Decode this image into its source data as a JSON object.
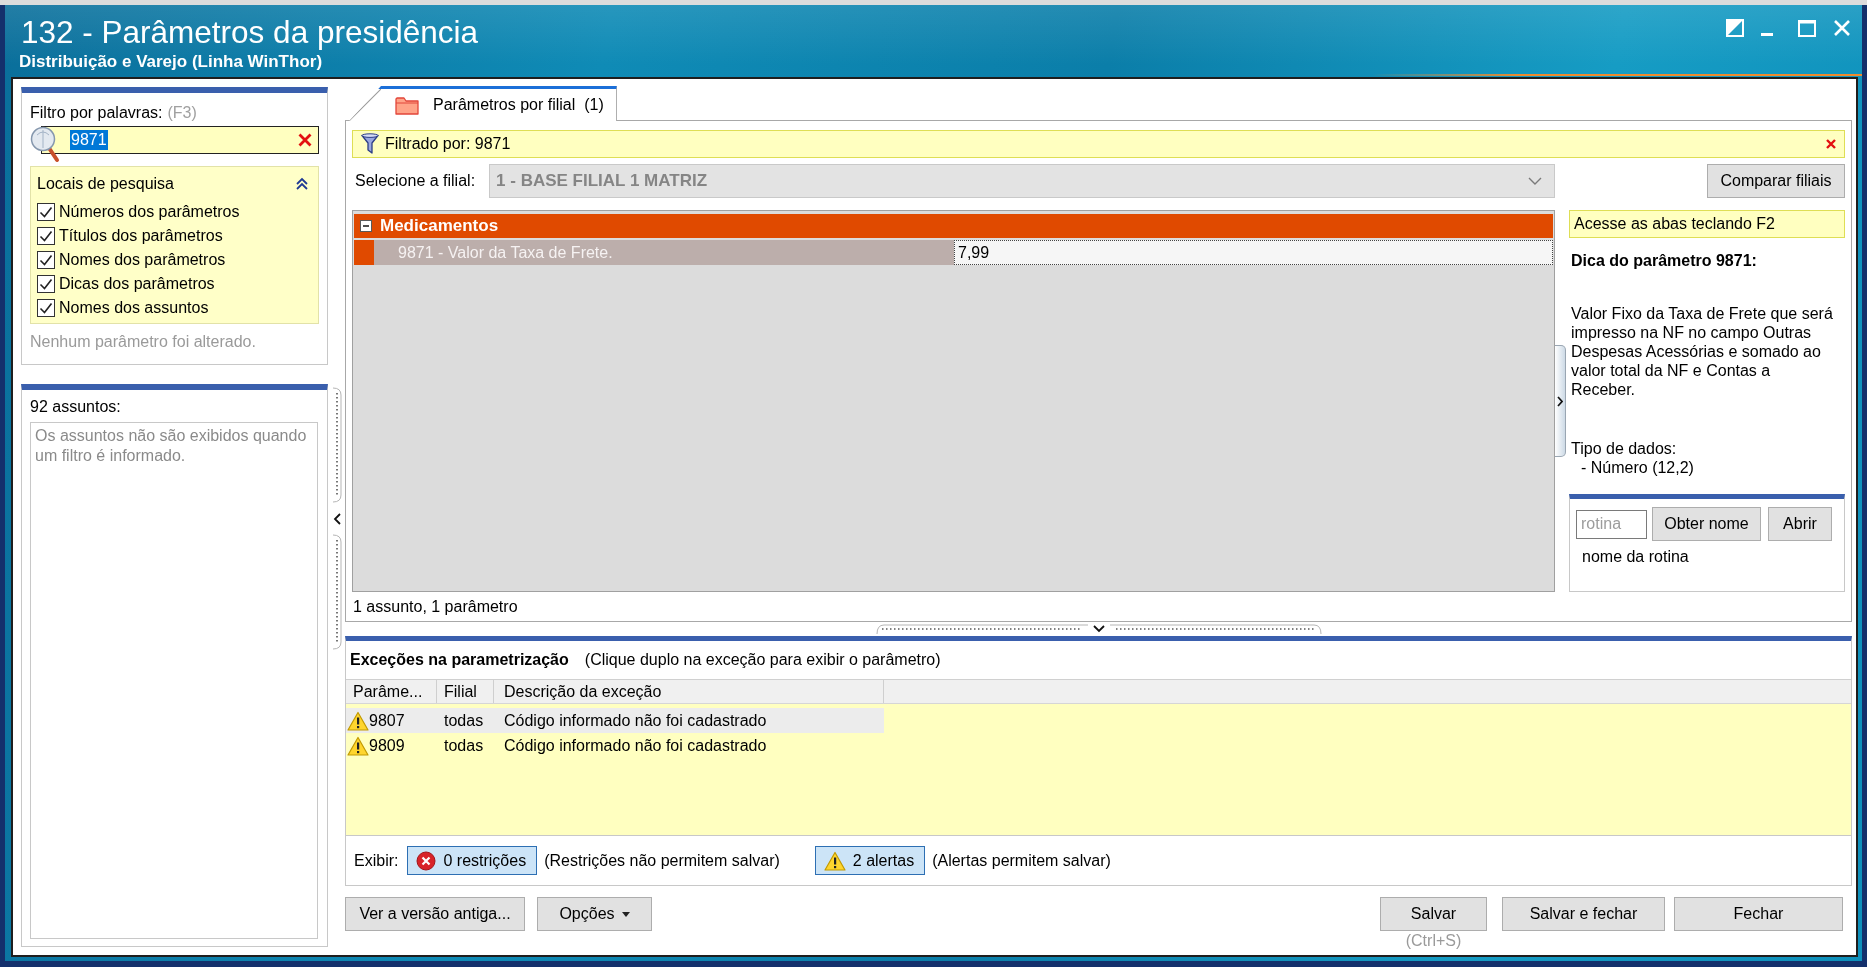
{
  "window": {
    "title": "132 - Parâmetros da presidência",
    "subtitle": "Distribuição e Varejo (Linha WinThor)"
  },
  "filter_panel": {
    "label": "Filtro por palavras:",
    "shortcut": "(F3)",
    "search": {
      "value": "9871",
      "value_selected": true
    },
    "search_locations": {
      "title": "Locais de pesquisa",
      "expanded": true,
      "options": [
        {
          "label": "Números dos parâmetros",
          "checked": true
        },
        {
          "label": "Títulos dos parâmetros",
          "checked": true
        },
        {
          "label": "Nomes dos parâmetros",
          "checked": true
        },
        {
          "label": "Dicas dos parâmetros",
          "checked": true
        },
        {
          "label": "Nomes dos assuntos",
          "checked": true
        }
      ]
    },
    "status": "Nenhum parâmetro foi alterado."
  },
  "subjects_panel": {
    "label": "92 assuntos:",
    "message": "Os assuntos não são exibidos quando um filtro é informado."
  },
  "tabs": [
    {
      "label": "Parâmetros por filial",
      "count": "(1)",
      "selected": true
    }
  ],
  "filter_bar": {
    "text": "Filtrado por: 9871"
  },
  "branch_select": {
    "label": "Selecione a filial:",
    "value": "1 - BASE FILIAL 1 MATRIZ",
    "disabled": true
  },
  "compare_button": "Comparar filiais",
  "grid": {
    "groups": [
      {
        "name": "Medicamentos",
        "expanded": true,
        "rows": [
          {
            "name": "9871 - Valor da Taxa de Frete.",
            "value": "7,99",
            "selected": true
          }
        ]
      }
    ],
    "status": "1 assunto, 1 parâmetro"
  },
  "hint_panel": {
    "notice": "Acesse as abas teclando F2",
    "title": "Dica do parâmetro 9871:",
    "text": "Valor Fixo da Taxa de Frete que será impresso na NF no campo Outras Despesas Acessórias e somado ao valor total da NF e Contas a Receber.",
    "data_type_label": "Tipo de dados:",
    "data_type": "- Número (12,2)"
  },
  "routine_panel": {
    "placeholder": "rotina",
    "get_name_button": "Obter nome",
    "open_button": "Abrir",
    "name_label": "nome da rotina"
  },
  "exceptions": {
    "title": "Exceções na parametrização",
    "hint": "(Clique duplo na exceção para exibir o parâmetro)",
    "columns": [
      "Parâme...",
      "Filial",
      "Descrição da exceção"
    ],
    "rows": [
      {
        "kind": "alert",
        "parameter": "9807",
        "branch": "todas",
        "description": "Código informado não foi cadastrado",
        "selected": true
      },
      {
        "kind": "alert",
        "parameter": "9809",
        "branch": "todas",
        "description": "Código informado não foi cadastrado",
        "selected": false
      }
    ],
    "show_label": "Exibir:",
    "toggles": [
      {
        "kind": "restriction",
        "label": "0 restrições",
        "note": "(Restrições não permitem salvar)",
        "on": true
      },
      {
        "kind": "alert",
        "label": "2 alertas",
        "note": "(Alertas permitem salvar)",
        "on": true
      }
    ]
  },
  "footer": {
    "old_version_button": "Ver a versão antiga...",
    "options_button": "Opções",
    "save_button": "Salvar",
    "save_shortcut": "(Ctrl+S)",
    "save_close_button": "Salvar e fechar",
    "close_button": "Fechar"
  }
}
